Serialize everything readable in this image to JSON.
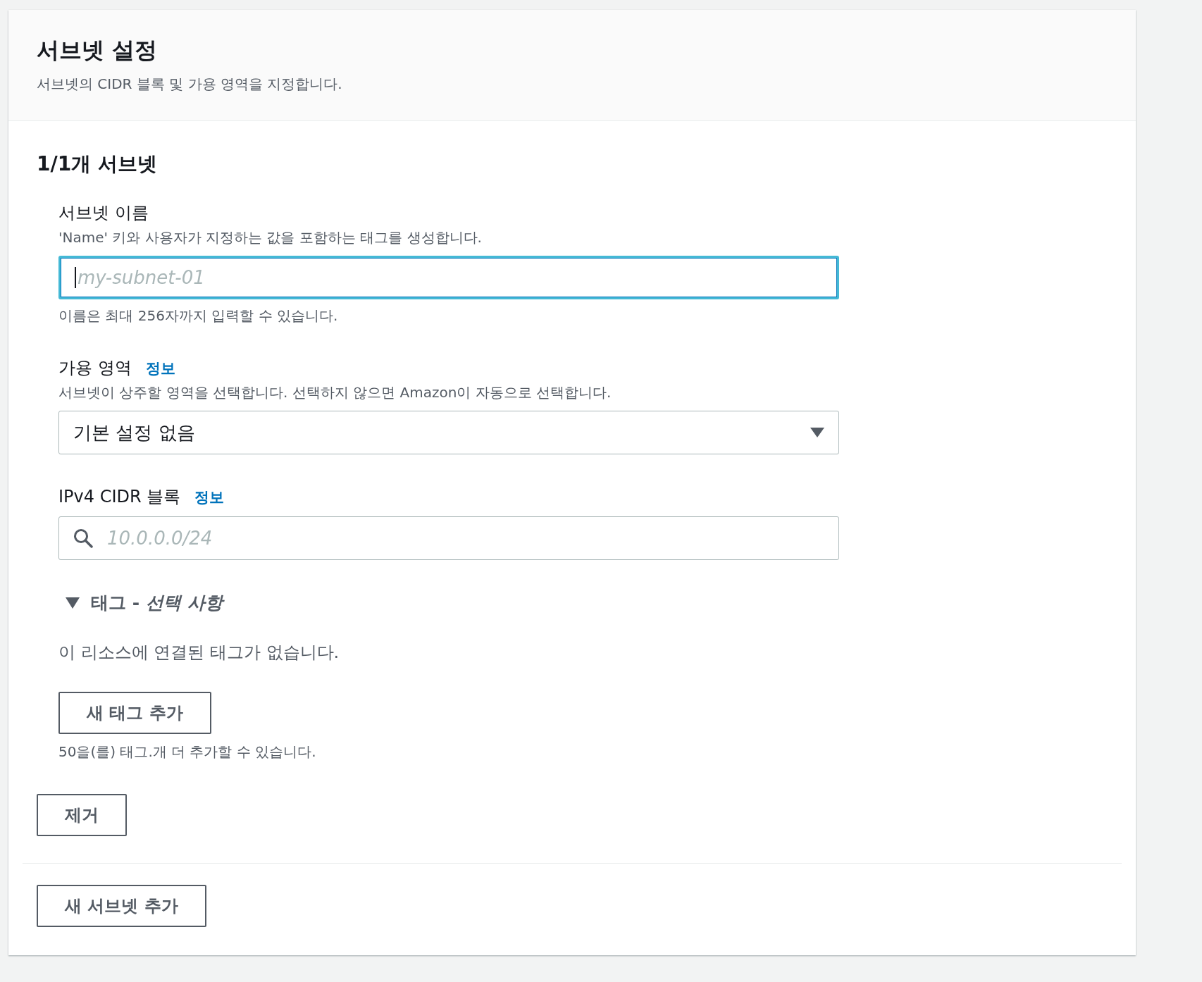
{
  "panel": {
    "title": "서브넷 설정",
    "description": "서브넷의 CIDR 블록 및 가용 영역을 지정합니다."
  },
  "subnet": {
    "heading": "1/1개 서브넷",
    "fields": [
      {
        "kind": "text",
        "label": "서브넷 이름",
        "description": "'Name' 키와 사용자가 지정하는 값을 포함하는 태그를 생성합니다.",
        "placeholder": "my-subnet-01",
        "focused": true,
        "constraint": "이름은 최대 256자까지 입력할 수 있습니다."
      },
      {
        "kind": "select",
        "label": "가용 영역",
        "info": "정보",
        "description": "서브넷이 상주할 영역을 선택합니다. 선택하지 않으면 Amazon이 자동으로 선택합니다.",
        "value": "기본 설정 없음"
      },
      {
        "kind": "search",
        "label": "IPv4 CIDR 블록",
        "info": "정보",
        "placeholder": "10.0.0.0/24",
        "focused": false
      }
    ],
    "tags": {
      "title": "태그 - *선택 사항*",
      "expanded": true,
      "empty_text": "이 리소스에 연결된 태그가 없습니다.",
      "add_button": "새 태그 추가",
      "limit_text": "50을(를) 태그.개 더 추가할 수 있습니다."
    },
    "remove_button": "제거"
  },
  "add_subnet_button": "새 서브넷 추가"
}
